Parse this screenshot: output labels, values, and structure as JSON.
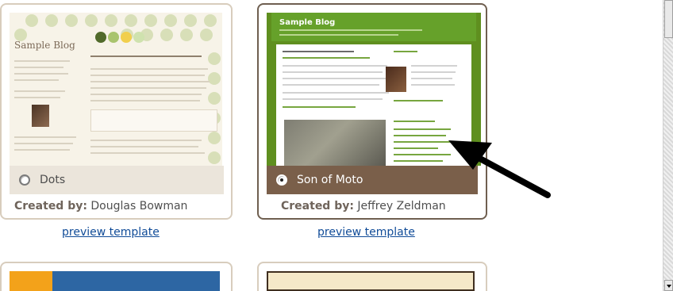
{
  "templates": [
    {
      "name": "Dots",
      "selected": false,
      "created_by_label": "Created by:",
      "author": "Douglas Bowman",
      "preview_label": "preview template",
      "thumbnail": {
        "blog_title": "Sample Blog"
      }
    },
    {
      "name": "Son of Moto",
      "selected": true,
      "created_by_label": "Created by:",
      "author": "Jeffrey Zeldman",
      "preview_label": "preview template",
      "thumbnail": {
        "blog_title": "Sample Blog"
      }
    }
  ],
  "annotation": {
    "icon": "arrow-icon",
    "color": "#000000"
  },
  "scrollbar": {
    "down_icon": "chevron-down-icon"
  }
}
